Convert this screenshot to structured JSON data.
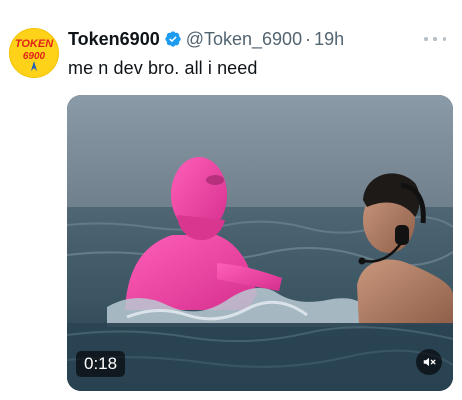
{
  "author": {
    "display_name": "Token6900",
    "handle": "@Token_6900",
    "time_sep": "·",
    "time": "19h",
    "avatar_text_top": "TOKEN",
    "avatar_text_bottom": "6900",
    "verified": true
  },
  "tweet": {
    "text": "me n dev bro. all i need"
  },
  "media": {
    "type": "video",
    "duration": "0:18",
    "muted": true
  },
  "icons": {
    "verified": "verified-badge-icon",
    "more": "more-options-icon",
    "mute": "muted-speaker-icon"
  },
  "colors": {
    "verified": "#1d9bf0",
    "handle": "#536471",
    "avatar_bg": "#ffd21a",
    "avatar_text": "#e0241b"
  }
}
